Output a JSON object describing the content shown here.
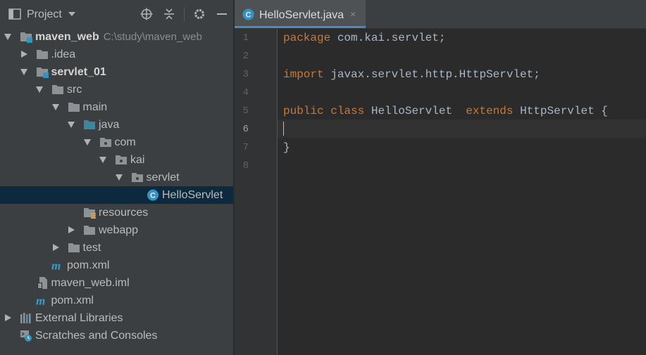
{
  "project_panel": {
    "title": "Project",
    "toolbar_icons": [
      "target-icon",
      "collapse-all-icon",
      "gear-icon",
      "minimize-icon"
    ]
  },
  "tree": [
    {
      "label": "maven_web",
      "path": "C:\\study\\maven_web",
      "bold": true,
      "depth": 0,
      "arrow": "open",
      "icon": "module-folder-icon"
    },
    {
      "label": ".idea",
      "depth": 1,
      "arrow": "closed",
      "icon": "folder-icon"
    },
    {
      "label": "servlet_01",
      "bold": true,
      "depth": 1,
      "arrow": "open",
      "icon": "module-folder-icon"
    },
    {
      "label": "src",
      "depth": 2,
      "arrow": "open",
      "icon": "folder-icon"
    },
    {
      "label": "main",
      "depth": 3,
      "arrow": "open",
      "icon": "folder-icon"
    },
    {
      "label": "java",
      "depth": 4,
      "arrow": "open",
      "icon": "source-folder-icon"
    },
    {
      "label": "com",
      "depth": 5,
      "arrow": "open",
      "icon": "package-icon"
    },
    {
      "label": "kai",
      "depth": 6,
      "arrow": "open",
      "icon": "package-icon"
    },
    {
      "label": "servlet",
      "depth": 7,
      "arrow": "open",
      "icon": "package-icon"
    },
    {
      "label": "HelloServlet",
      "depth": 8,
      "arrow": "none",
      "icon": "class-icon",
      "selected": true
    },
    {
      "label": "resources",
      "depth": 4,
      "arrow": "none",
      "icon": "resources-folder-icon"
    },
    {
      "label": "webapp",
      "depth": 4,
      "arrow": "closed",
      "icon": "folder-icon"
    },
    {
      "label": "test",
      "depth": 3,
      "arrow": "closed",
      "icon": "folder-icon"
    },
    {
      "label": "pom.xml",
      "depth": 2,
      "arrow": "none",
      "icon": "maven-icon"
    },
    {
      "label": "maven_web.iml",
      "depth": 1,
      "arrow": "none",
      "icon": "iml-file-icon"
    },
    {
      "label": "pom.xml",
      "depth": 1,
      "arrow": "none",
      "icon": "maven-icon"
    },
    {
      "label": "External Libraries",
      "depth": 0,
      "arrow": "closed",
      "icon": "libraries-icon"
    },
    {
      "label": "Scratches and Consoles",
      "depth": 0,
      "arrow": "none",
      "icon": "scratches-icon"
    }
  ],
  "editor": {
    "tab": {
      "label": "HelloServlet.java",
      "close": "×",
      "icon": "class-icon"
    },
    "current_line": 6,
    "lines": [
      {
        "n": "1",
        "tokens": [
          {
            "t": "package",
            "k": true
          },
          {
            "t": " com.kai.servlet;",
            "k": false
          }
        ]
      },
      {
        "n": "2",
        "tokens": []
      },
      {
        "n": "3",
        "tokens": [
          {
            "t": "import",
            "k": true
          },
          {
            "t": " javax.servlet.http.HttpServlet;",
            "k": false
          }
        ]
      },
      {
        "n": "4",
        "tokens": []
      },
      {
        "n": "5",
        "tokens": [
          {
            "t": "public",
            "k": true
          },
          {
            "t": " ",
            "k": false
          },
          {
            "t": "class",
            "k": true
          },
          {
            "t": " HelloServlet  ",
            "k": false
          },
          {
            "t": "extends",
            "k": true
          },
          {
            "t": " HttpServlet {",
            "k": false
          }
        ]
      },
      {
        "n": "6",
        "tokens": []
      },
      {
        "n": "7",
        "tokens": [
          {
            "t": "}",
            "k": false
          }
        ]
      },
      {
        "n": "8",
        "tokens": []
      }
    ]
  },
  "colors": {
    "panel_bg": "#3c3f41",
    "editor_bg": "#2b2b2b",
    "keyword": "#cc7832",
    "code_text": "#a9b7c6",
    "selection": "#0d293e",
    "tab_accent": "#4a88c7"
  }
}
